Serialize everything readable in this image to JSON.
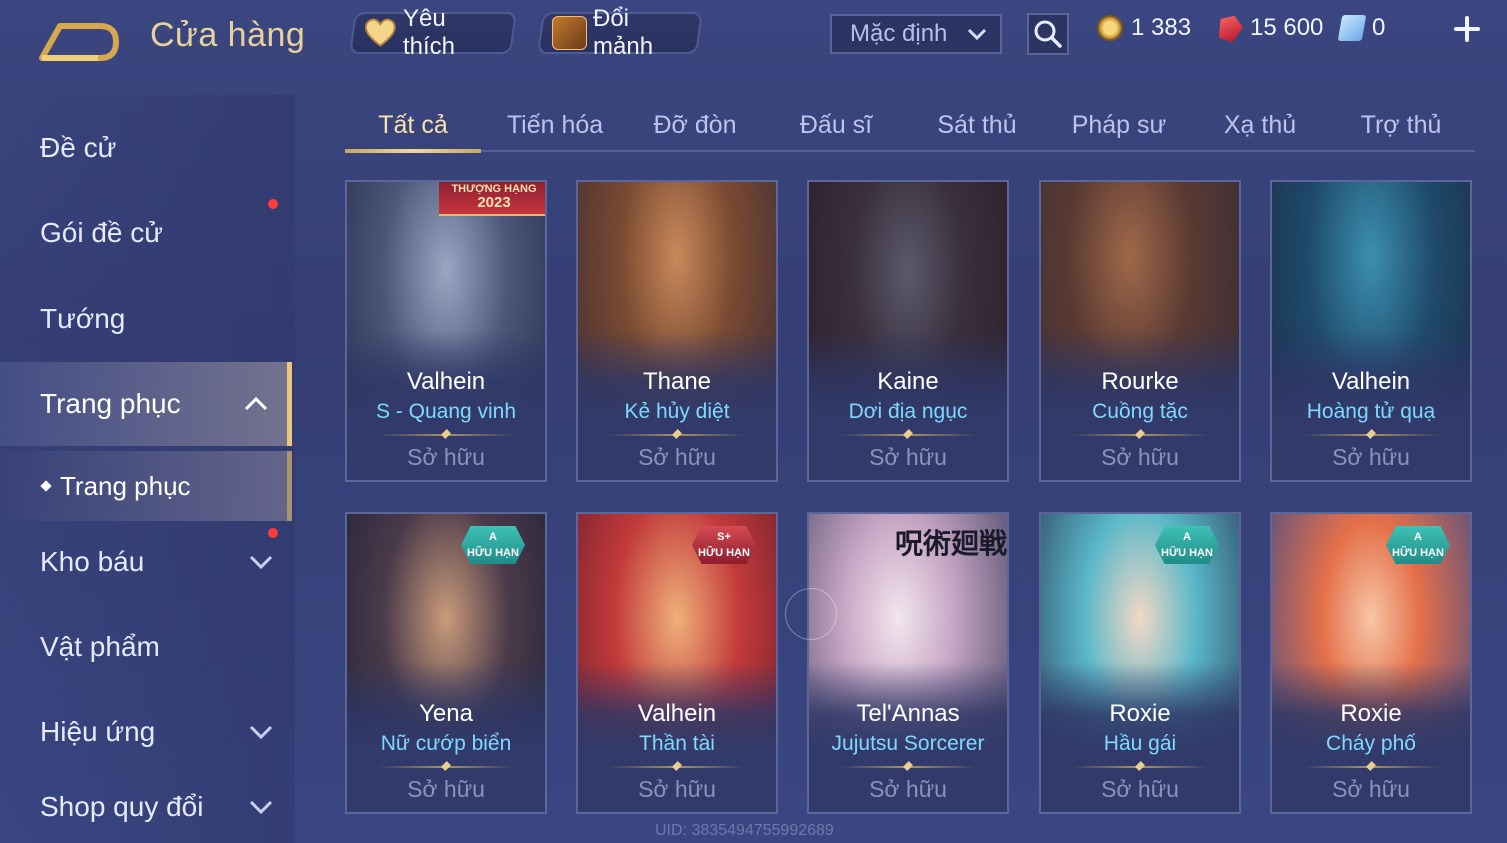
{
  "header": {
    "title": "Cửa hàng",
    "favorites_label": "Yêu thích",
    "exchange_label": "Đổi mảnh",
    "sort_value": "Mặc định",
    "currencies": {
      "gold": "1 383",
      "gems": "15 600",
      "vouchers": "0"
    }
  },
  "sidebar": {
    "items": [
      {
        "label": "Đề cử"
      },
      {
        "label": "Gói đề cử"
      },
      {
        "label": "Tướng"
      },
      {
        "label": "Trang phục"
      },
      {
        "label": "Kho báu"
      },
      {
        "label": "Vật phẩm"
      },
      {
        "label": "Hiệu ứng"
      },
      {
        "label": "Shop quy đổi"
      }
    ],
    "sub_item": "Trang phục"
  },
  "tabs": [
    "Tất cả",
    "Tiến hóa",
    "Đỡ đòn",
    "Đấu sĩ",
    "Sát thủ",
    "Pháp sư",
    "Xạ thủ",
    "Trợ thủ"
  ],
  "cards": [
    {
      "hero": "Valhein",
      "skin": "S - Quang vinh",
      "status": "Sở hữu",
      "banner_top": "THƯỢNG HẠNG",
      "banner_year": "2023"
    },
    {
      "hero": "Thane",
      "skin": "Kẻ hủy diệt",
      "status": "Sở hữu"
    },
    {
      "hero": "Kaine",
      "skin": "Dơi địa ngục",
      "status": "Sở hữu"
    },
    {
      "hero": "Rourke",
      "skin": "Cuồng tặc",
      "status": "Sở hữu"
    },
    {
      "hero": "Valhein",
      "skin": "Hoàng tử quạ",
      "status": "Sở hữu"
    },
    {
      "hero": "Yena",
      "skin": "Nữ cướp biển",
      "status": "Sở hữu",
      "badge_grade": "A",
      "badge_text": "HỮU HẠN"
    },
    {
      "hero": "Valhein",
      "skin": "Thần tài",
      "status": "Sở hữu",
      "badge_grade": "S+",
      "badge_text": "HỮU HẠN"
    },
    {
      "hero": "Tel'Annas",
      "skin": "Jujutsu Sorcerer",
      "status": "Sở hữu",
      "logo_text": "呪術廻戦"
    },
    {
      "hero": "Roxie",
      "skin": "Hầu gái",
      "status": "Sở hữu",
      "badge_grade": "A",
      "badge_text": "HỮU HẠN"
    },
    {
      "hero": "Roxie",
      "skin": "Cháy phố",
      "status": "Sở hữu",
      "badge_grade": "A",
      "badge_text": "HỮU HẠN"
    }
  ],
  "watermark": "UID: 3835494755992689",
  "colors": {
    "accent_gold": "#e9d29a",
    "skin_name": "#7fd8ff",
    "notify_dot": "#ff3b3b"
  }
}
